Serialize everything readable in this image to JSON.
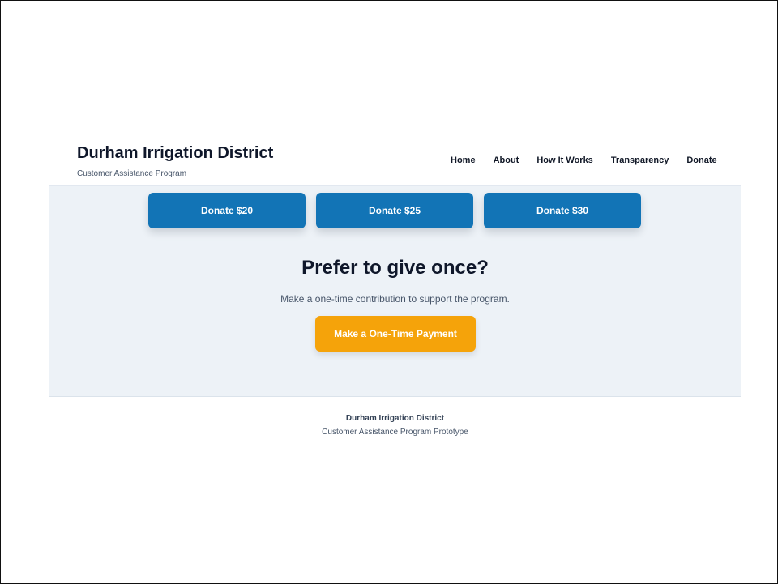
{
  "header": {
    "title": "Durham Irrigation District",
    "subtitle": "Customer Assistance Program",
    "nav": [
      "Home",
      "About",
      "How It Works",
      "Transparency",
      "Donate"
    ]
  },
  "hero": {
    "donate_buttons": [
      "Donate $20",
      "Donate $25",
      "Donate $30"
    ],
    "once_title": "Prefer to give once?",
    "once_text": "Make a one-time contribution to support the program.",
    "payment_button": "Make a One-Time Payment"
  },
  "footer": {
    "title": "Durham Irrigation District",
    "subtitle": "Customer Assistance Program Prototype"
  },
  "colors": {
    "primary": "#1274b6",
    "accent": "#f5a30a",
    "hero_background": "#edf2f7",
    "text": "#0f172a"
  }
}
